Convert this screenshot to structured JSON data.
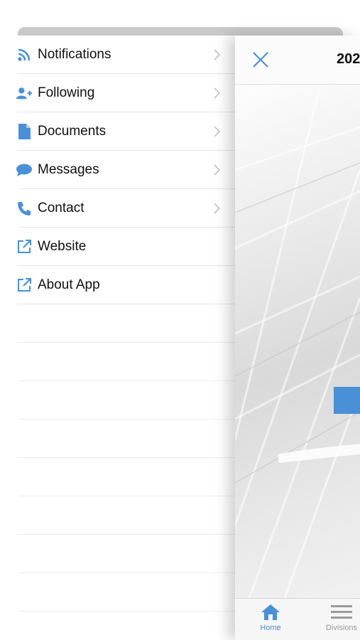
{
  "menu": {
    "items": [
      {
        "label": "Notifications",
        "icon": "rss-icon",
        "chevron": true
      },
      {
        "label": "Following",
        "icon": "add-user-icon",
        "chevron": true
      },
      {
        "label": "Documents",
        "icon": "document-icon",
        "chevron": true
      },
      {
        "label": "Messages",
        "icon": "chat-bubble-icon",
        "chevron": true
      },
      {
        "label": "Contact",
        "icon": "phone-icon",
        "chevron": true
      },
      {
        "label": "Website",
        "icon": "external-link-icon",
        "chevron": false
      },
      {
        "label": "About App",
        "icon": "external-link-icon",
        "chevron": false
      }
    ]
  },
  "panel": {
    "title": "202",
    "close_icon": "close-icon"
  },
  "tabbar": {
    "tabs": [
      {
        "label": "Home",
        "icon": "home-icon",
        "active": true
      },
      {
        "label": "Divisions",
        "icon": "menu-lines-icon",
        "active": false
      }
    ]
  },
  "colors": {
    "accent": "#4a90d9",
    "text": "#111111",
    "divider": "#e6e6e6",
    "chevron": "#c4c4c4",
    "tab_inactive": "#9a9a9a"
  }
}
